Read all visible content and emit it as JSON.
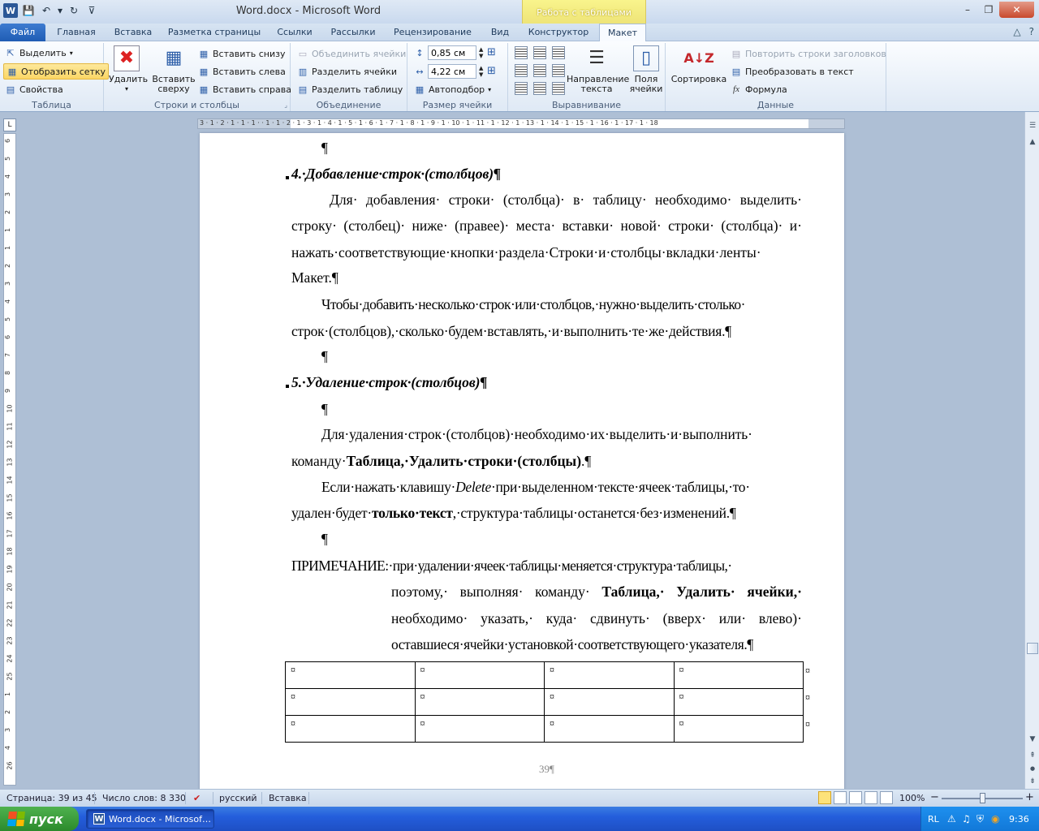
{
  "window": {
    "title": "Word.docx  -  Microsoft Word",
    "context_group": "Работа с таблицами",
    "minimize_glyph": "–",
    "maximize_glyph": "❐",
    "close_glyph": "✕"
  },
  "qat": {
    "app_icon_glyph": "W",
    "save_glyph": "💾",
    "undo_glyph": "↶",
    "redo_glyph": "↻",
    "dropdown_glyph": "▾",
    "customize_glyph": "⊽"
  },
  "tabs": [
    {
      "label": "Файл"
    },
    {
      "label": "Главная"
    },
    {
      "label": "Вставка"
    },
    {
      "label": "Разметка страницы"
    },
    {
      "label": "Ссылки"
    },
    {
      "label": "Рассылки"
    },
    {
      "label": "Рецензирование"
    },
    {
      "label": "Вид"
    },
    {
      "label": "Конструктор"
    },
    {
      "label": "Макет"
    }
  ],
  "tabs_right": {
    "minimize_ribbon_glyph": "△",
    "help_glyph": "?"
  },
  "ribbon": {
    "table": {
      "label": "Таблица",
      "select": "Выделить",
      "show_grid": "Отобразить сетку",
      "properties": "Свойства"
    },
    "rows_cols": {
      "label": "Строки и столбцы",
      "delete": "Удалить",
      "insert_above_1": "Вставить",
      "insert_above_2": "сверху",
      "insert_below": "Вставить снизу",
      "insert_left": "Вставить слева",
      "insert_right": "Вставить справа"
    },
    "merge": {
      "label": "Объединение",
      "merge_cells": "Объединить ячейки",
      "split_cells": "Разделить ячейки",
      "split_table": "Разделить таблицу"
    },
    "cell_size": {
      "label": "Размер ячейки",
      "height": "0,85 см",
      "width": "4,22 см",
      "autofit": "Автоподбор"
    },
    "alignment": {
      "label": "Выравнивание",
      "text_direction_1": "Направление",
      "text_direction_2": "текста",
      "cell_margins_1": "Поля",
      "cell_margins_2": "ячейки"
    },
    "data": {
      "label": "Данные",
      "sort": "Сортировка",
      "repeat_header": "Повторить строки заголовков",
      "convert_text": "Преобразовать в текст",
      "formula": "Формула"
    }
  },
  "ruler": {
    "corner": "L",
    "h_text": "3 · 1 · 2 · 1 · 1 · 1 ·  · 1 · 1 · 2 · 1 · 3 · 1 · 4 · 1 · 5 · 1 · 6 · 1 · 7 · 1 · 8 · 1 · 9 · 1 · 10 · 1 · 11 · 1 · 12 · 1 · 13 · 1 · 14 · 1 · 15 · 1 · 16 · 1 · 17 · 1 · 18",
    "v_ticks": [
      "6",
      "5",
      "4",
      "3",
      "2",
      "1",
      "1",
      "2",
      "3",
      "4",
      "5",
      "6",
      "7",
      "8",
      "9",
      "10",
      "11",
      "12",
      "13",
      "14",
      "15",
      "16",
      "17",
      "18",
      "19",
      "20",
      "21",
      "22",
      "23",
      "24",
      "25",
      "1",
      "2",
      "3",
      "4",
      "26"
    ]
  },
  "document": {
    "pilcrow": "¶",
    "heading1": "4.·Добавление·строк·(столбцов)¶",
    "p1_l1": [
      "Для·",
      "добавления·",
      "строки·",
      "(столбца)·",
      "в·",
      "таблицу·",
      "необходимо·",
      "выделить·"
    ],
    "p1_l2": [
      "строку·",
      "(столбец)·",
      "ниже·",
      "(правее)·",
      "места·",
      "вставки·",
      "новой·",
      "строки·",
      "(столбца)·",
      "и·"
    ],
    "p1_l3": [
      "нажать·соответствующие·кнопки·раздела·Строки·и·столбцы·вкладки·ленты·"
    ],
    "p1_l4": "Макет.¶",
    "p2_l1": "Чтобы·добавить·несколько·строк·или·столбцов,·нужно·выделить·столько·",
    "p2_l2": "строк·(столбцов),·сколько·будем·вставлять,·и·выполнить·те·же·действия.¶",
    "heading2": "5.·Удаление·строк·(столбцов)¶",
    "p3_l1": "Для·удаления·строк·(столбцов)·необходимо·их·выделить·и·выполнить·",
    "p3_l2_pre": "команду·",
    "p3_l2_bold": "Таблица,·Удалить·строки·(столбцы)",
    "p3_l2_post": ".¶",
    "p4_l1_pre": "Если·нажать·клавишу·",
    "p4_l1_em": "Delete",
    "p4_l1_post": "·при·выделенном·тексте·ячеек·таблицы,·то·",
    "p4_l2_pre": "удален·будет·",
    "p4_l2_bold": "только·текст",
    "p4_l2_post": ",·структура·таблицы·останется·без·изменений.¶",
    "note_l1": "ПРИМЕЧАНИЕ:·при·удалении·ячеек·таблицы·меняется·структура·таблицы,·",
    "note_l2": [
      "поэтому,·",
      "выполняя·",
      "команду·",
      "Таблица,·",
      "Удалить·",
      "ячейки,·"
    ],
    "note_l3": [
      "необходимо·",
      "указать,·",
      "куда·",
      "сдвинуть·",
      "(вверх·",
      "или·",
      "влево)·"
    ],
    "note_l4": "оставшиеся·ячейки·установкой·соответствующего·указателя.¶",
    "cell_mark": "¤",
    "page_number": "39¶"
  },
  "scrollbar": {
    "up": "▲",
    "down": "▼",
    "split": "☰",
    "prev": "⇞",
    "browse": "●",
    "next": "⇟"
  },
  "status": {
    "page": "Страница: 39 из 45",
    "words": "Число слов: 8 330",
    "spell_glyph": "✔",
    "language": "русский",
    "mode": "Вставка",
    "zoom": "100%",
    "zoom_minus": "−",
    "zoom_plus": "+"
  },
  "taskbar": {
    "start": "пуск",
    "task": "Word.docx - Microsof…",
    "lang": "RL",
    "time": "9:36"
  },
  "colors": {
    "accent": "#2b5797",
    "context_tab": "#f3eb7d",
    "selected_button": "#fbd665",
    "taskbar": "#245edc",
    "start": "#3a9d3a"
  }
}
